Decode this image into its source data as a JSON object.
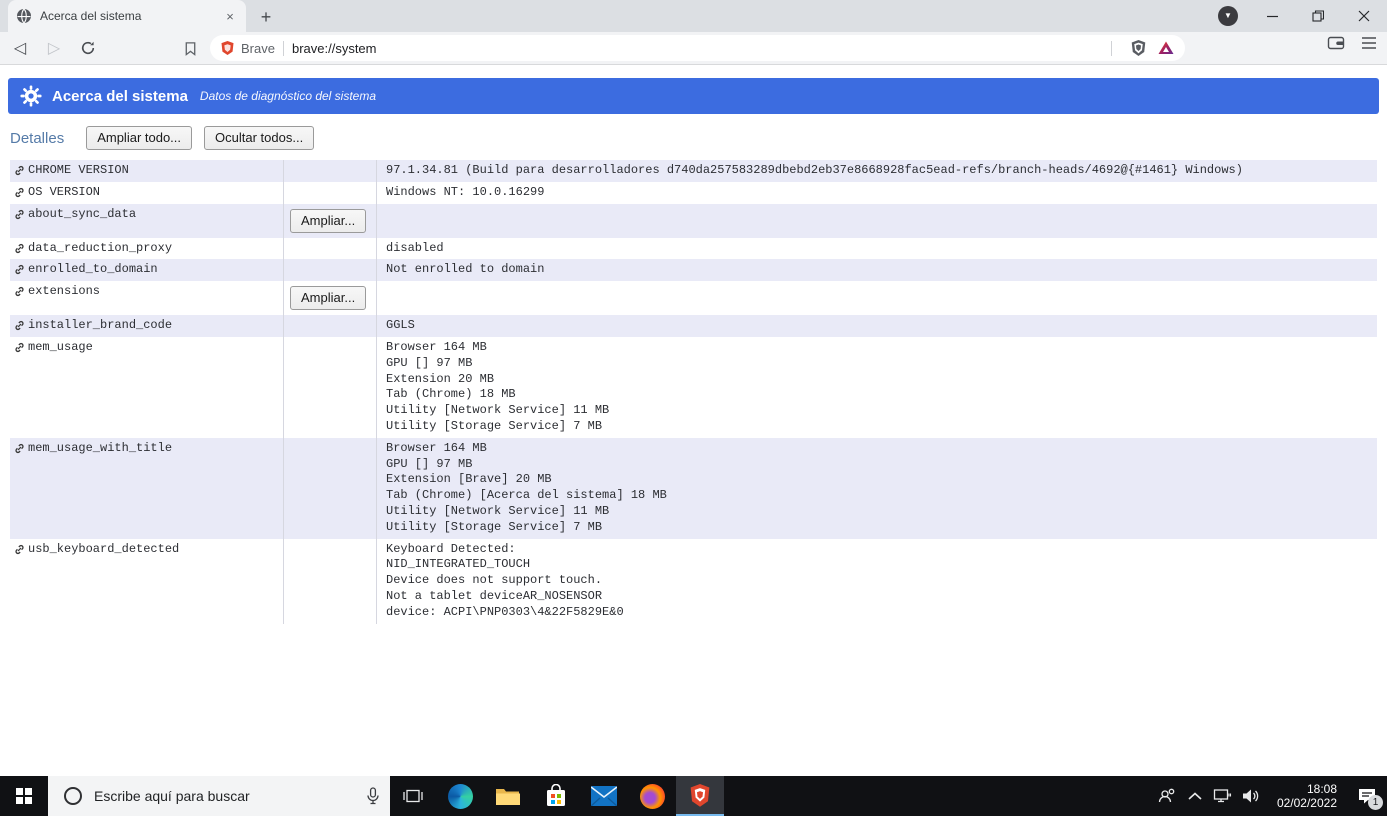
{
  "tab": {
    "title": "Acerca del sistema",
    "close": "×",
    "new_tab": "+"
  },
  "toolbar": {
    "site_chip": "Brave",
    "url": "brave://system"
  },
  "header": {
    "title": "Acerca del sistema",
    "subtitle": "Datos de diagnóstico del sistema",
    "bg_color": "#3c6ce0"
  },
  "controls": {
    "details": "Detalles",
    "expand_all": "Ampliar todo...",
    "collapse_all": "Ocultar todos...",
    "expand": "Ampliar..."
  },
  "table": {
    "rows": [
      {
        "name": "CHROME VERSION",
        "value": "97.1.34.81 (Build para desarrolladores d740da257583289dbebd2eb37e8668928fac5ead-refs/branch-heads/4692@{#1461} Windows)"
      },
      {
        "name": "OS VERSION",
        "value": "Windows NT: 10.0.16299"
      },
      {
        "name": "about_sync_data",
        "value": "",
        "has_button": true
      },
      {
        "name": "data_reduction_proxy",
        "value": "disabled"
      },
      {
        "name": "enrolled_to_domain",
        "value": "Not enrolled to domain"
      },
      {
        "name": "extensions",
        "value": "",
        "has_button": true
      },
      {
        "name": "installer_brand_code",
        "value": "GGLS"
      },
      {
        "name": "mem_usage",
        "value": "Browser 164 MB\nGPU [] 97 MB\nExtension 20 MB\nTab (Chrome) 18 MB\nUtility [Network Service] 11 MB\nUtility [Storage Service] 7 MB"
      },
      {
        "name": "mem_usage_with_title",
        "value": "Browser 164 MB\nGPU [] 97 MB\nExtension [Brave] 20 MB\nTab (Chrome) [Acerca del sistema] 18 MB\nUtility [Network Service] 11 MB\nUtility [Storage Service] 7 MB"
      },
      {
        "name": "usb_keyboard_detected",
        "value": "Keyboard Detected:\nNID_INTEGRATED_TOUCH\nDevice does not support touch.\nNot a tablet deviceAR_NOSENSOR\ndevice: ACPI\\PNP0303\\4&22F5829E&0"
      }
    ]
  },
  "taskbar": {
    "search_placeholder": "Escribe aquí para buscar",
    "time": "18:08",
    "date": "02/02/2022",
    "notification_count": "1"
  }
}
